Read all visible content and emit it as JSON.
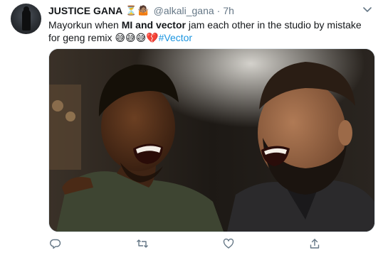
{
  "tweet": {
    "author_name": "JUSTICE GANA",
    "author_badges": "⏳🤷🏽",
    "handle": "@alkali_gana",
    "separator": "·",
    "time": "7h",
    "text_prefix": "Mayorkun when ",
    "text_bold": "MI and vector",
    "text_middle": " jam each other in the studio by mistake for geng remix ",
    "text_emojis": "😅😅😅💔",
    "hashtag": "#Vector"
  },
  "icons": {
    "menu": "chevron-down-icon",
    "reply": "reply-icon",
    "retweet": "retweet-icon",
    "like": "like-icon",
    "share": "share-icon"
  },
  "colors": {
    "link": "#1b95e0",
    "secondary_text": "#657786",
    "icon": "#657786"
  }
}
